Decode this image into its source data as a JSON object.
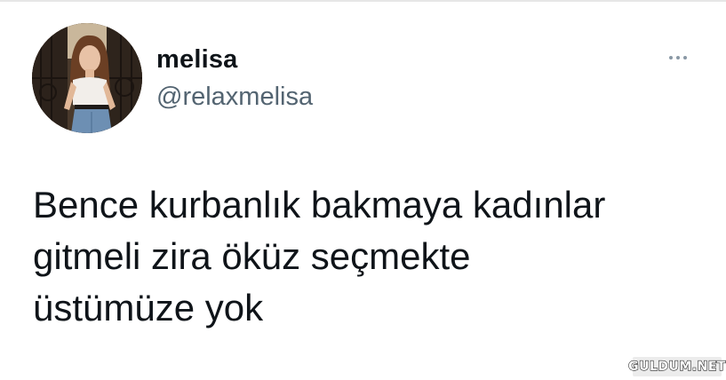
{
  "tweet": {
    "author": {
      "display_name": "melisa",
      "handle": "@relaxmelisa",
      "avatar_icon": "profile-photo"
    },
    "more_icon": "ellipsis-icon",
    "text_lines": [
      "Bence kurbanlık bakmaya kadınlar",
      "gitmeli zira öküz seçmekte",
      "üstümüze yok"
    ]
  },
  "watermark": {
    "text": "GULDUM.NET"
  },
  "colors": {
    "text_primary": "#0f1419",
    "text_secondary": "#536471",
    "background": "#ffffff"
  }
}
